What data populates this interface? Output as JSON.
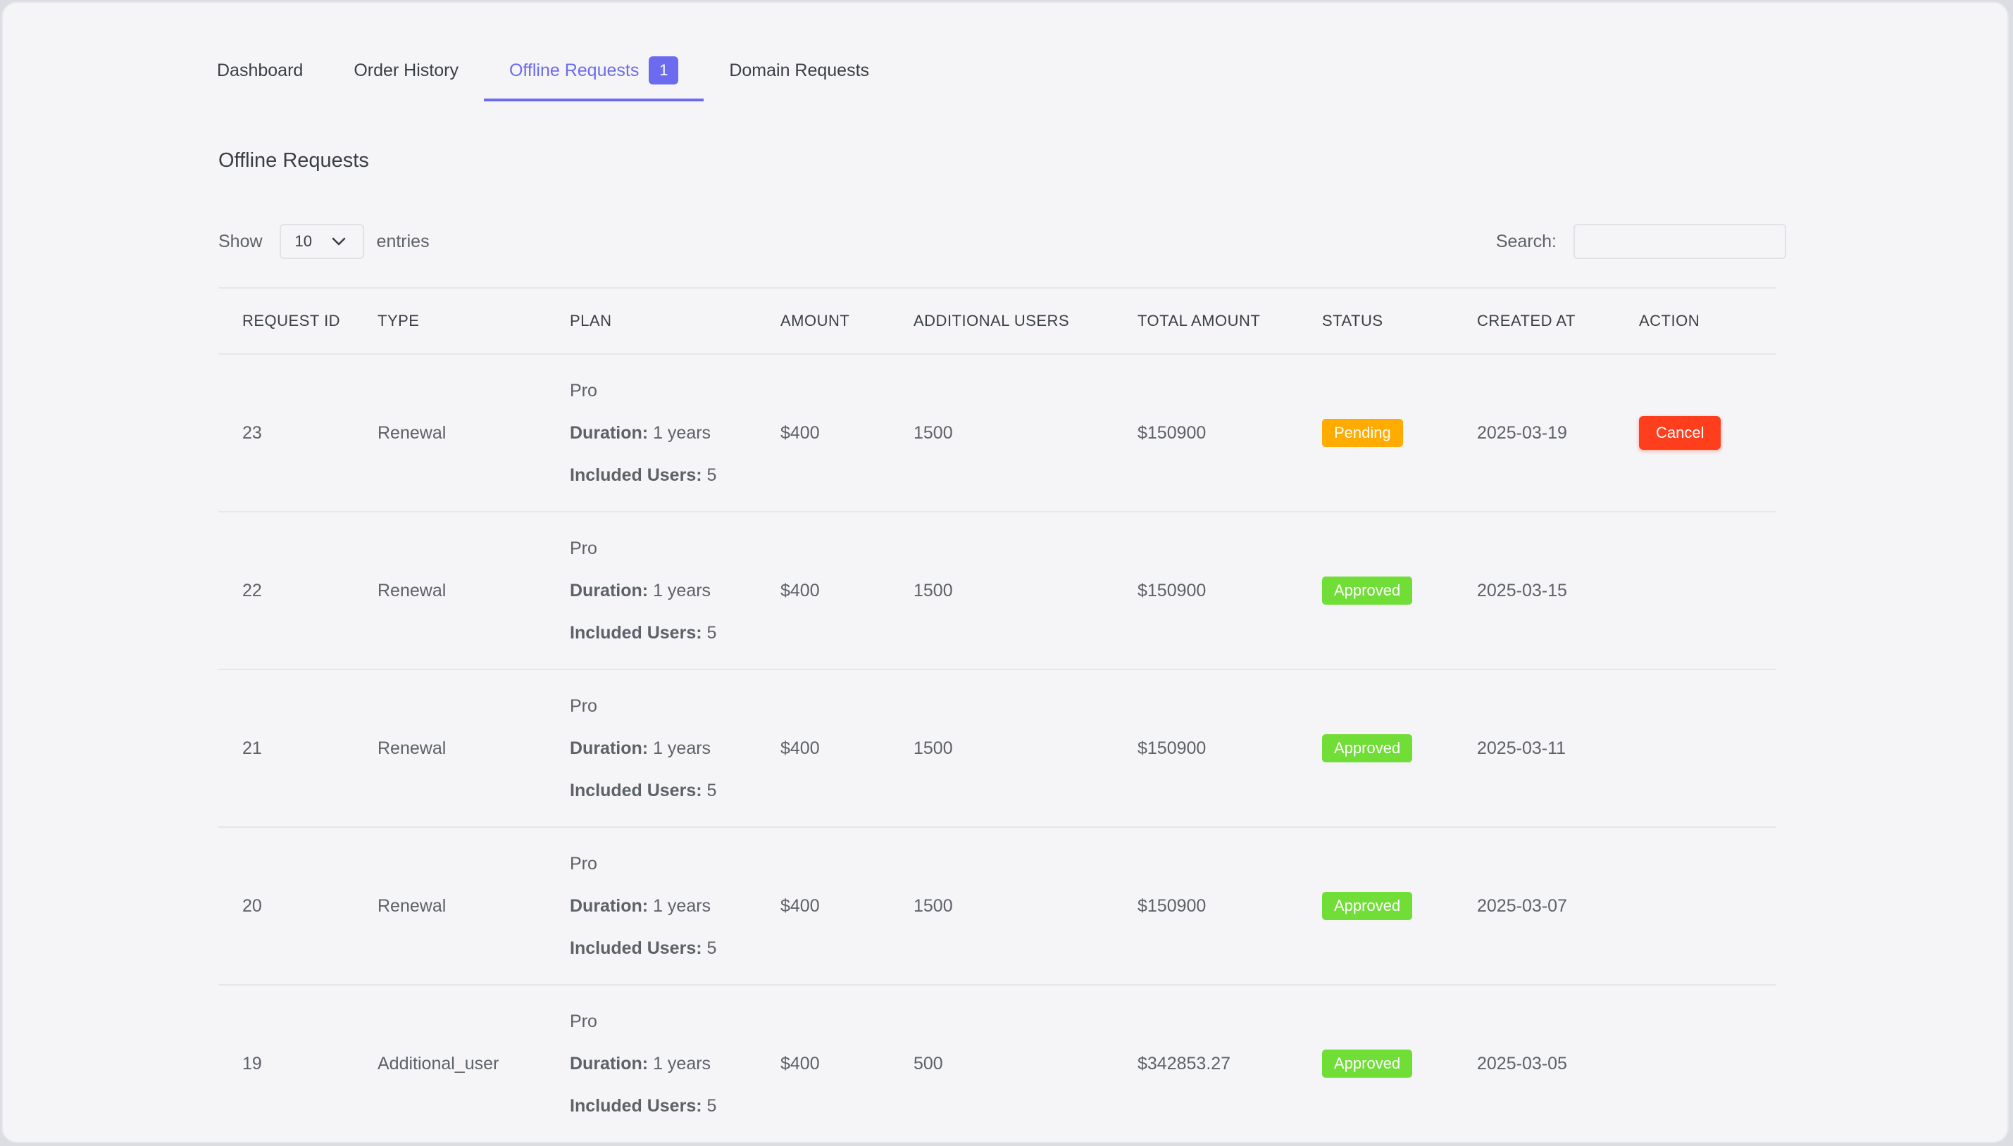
{
  "tabs": [
    {
      "label": "Dashboard"
    },
    {
      "label": "Order History"
    },
    {
      "label": "Offline Requests",
      "badge": "1"
    },
    {
      "label": "Domain Requests"
    }
  ],
  "page_title": "Offline Requests",
  "length": {
    "show_label": "Show",
    "value": "10",
    "entries_label": "entries"
  },
  "search": {
    "label": "Search:",
    "value": ""
  },
  "columns": [
    "REQUEST ID",
    "TYPE",
    "PLAN",
    "AMOUNT",
    "ADDITIONAL USERS",
    "TOTAL AMOUNT",
    "STATUS",
    "CREATED AT",
    "ACTION"
  ],
  "plan_labels": {
    "duration": "Duration:",
    "users": "Included Users:"
  },
  "rows": [
    {
      "id": "23",
      "type": "Renewal",
      "plan": "Pro",
      "duration": "1 years",
      "users": "5",
      "amount": "$400",
      "additional": "1500",
      "total": "$150900",
      "status": "Pending",
      "created": "2025-03-19",
      "action": "Cancel"
    },
    {
      "id": "22",
      "type": "Renewal",
      "plan": "Pro",
      "duration": "1 years",
      "users": "5",
      "amount": "$400",
      "additional": "1500",
      "total": "$150900",
      "status": "Approved",
      "created": "2025-03-15",
      "action": ""
    },
    {
      "id": "21",
      "type": "Renewal",
      "plan": "Pro",
      "duration": "1 years",
      "users": "5",
      "amount": "$400",
      "additional": "1500",
      "total": "$150900",
      "status": "Approved",
      "created": "2025-03-11",
      "action": ""
    },
    {
      "id": "20",
      "type": "Renewal",
      "plan": "Pro",
      "duration": "1 years",
      "users": "5",
      "amount": "$400",
      "additional": "1500",
      "total": "$150900",
      "status": "Approved",
      "created": "2025-03-07",
      "action": ""
    },
    {
      "id": "19",
      "type": "Additional_user",
      "plan": "Pro",
      "duration": "1 years",
      "users": "5",
      "amount": "$400",
      "additional": "500",
      "total": "$342853.27",
      "status": "Approved",
      "created": "2025-03-05",
      "action": ""
    }
  ],
  "colors": {
    "accent": "#6c6bf0",
    "pending": "#ffab00",
    "approved": "#71dd37",
    "danger": "#ff3e1d"
  }
}
